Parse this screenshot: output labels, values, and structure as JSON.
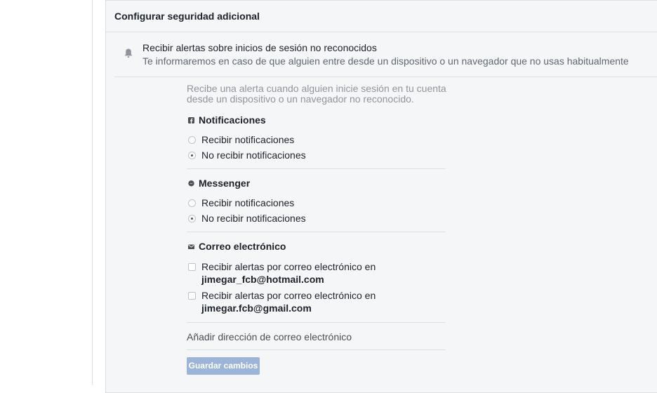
{
  "panel": {
    "title": "Configurar seguridad adicional"
  },
  "alert": {
    "icon": "bell-icon",
    "title": "Recibir alertas sobre inicios de sesión no reconocidos",
    "description": "Te informaremos en caso de que alguien entre desde un dispositivo o un navegador que no usas habitualmente"
  },
  "settings": {
    "intro": "Recibe una alerta cuando alguien inicie sesión en tu cuenta desde un dispositivo o un navegador no reconocido.",
    "notifications": {
      "icon": "facebook-icon",
      "title": "Notificaciones",
      "options": [
        {
          "label": "Recibir notificaciones",
          "selected": false
        },
        {
          "label": "No recibir notificaciones",
          "selected": true
        }
      ]
    },
    "messenger": {
      "icon": "messenger-icon",
      "title": "Messenger",
      "options": [
        {
          "label": "Recibir notificaciones",
          "selected": false
        },
        {
          "label": "No recibir notificaciones",
          "selected": true
        }
      ]
    },
    "email": {
      "icon": "envelope-icon",
      "title": "Correo electrónico",
      "options": [
        {
          "label": "Recibir alertas por correo electrónico en",
          "address": "jimegar_fcb@hotmail.com",
          "checked": false
        },
        {
          "label": "Recibir alertas por correo electrónico en",
          "address": "jimegar.fcb@gmail.com",
          "checked": false
        }
      ]
    },
    "add_email_label": "Añadir dirección de correo electrónico",
    "save_label": "Guardar cambios"
  },
  "colors": {
    "accent_disabled": "#9cb4d8",
    "panel_bg": "#f5f6f7",
    "border": "#dddfe2"
  }
}
